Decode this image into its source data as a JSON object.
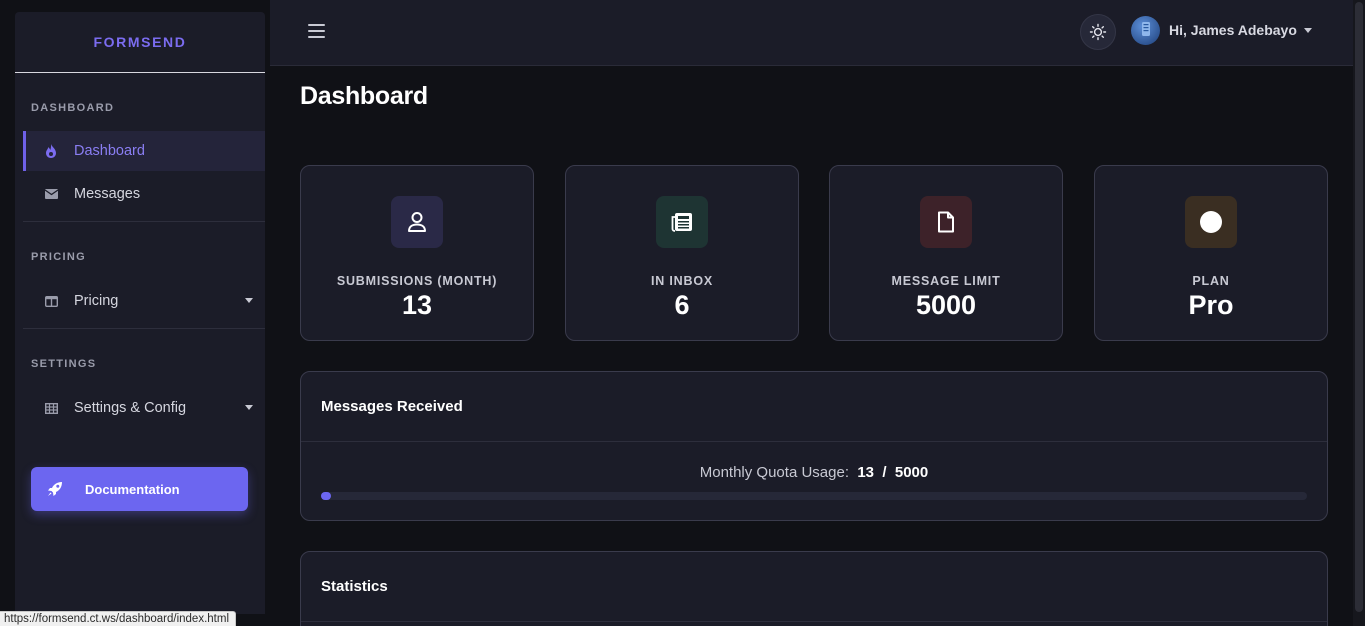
{
  "brand": "FORMSEND",
  "sidebar": {
    "sections": [
      {
        "title": "DASHBOARD",
        "items": [
          {
            "label": "Dashboard",
            "icon": "fire-icon",
            "active": true
          },
          {
            "label": "Messages",
            "icon": "envelope-icon",
            "active": false
          }
        ]
      },
      {
        "title": "PRICING",
        "items": [
          {
            "label": "Pricing",
            "icon": "columns-icon",
            "active": false,
            "dropdown": true
          }
        ]
      },
      {
        "title": "SETTINGS",
        "items": [
          {
            "label": "Settings & Config",
            "icon": "table-icon",
            "active": false,
            "dropdown": true
          }
        ]
      }
    ],
    "doc_button": {
      "label": "Documentation",
      "icon": "rocket-icon"
    }
  },
  "topbar": {
    "menu_icon": "hamburger-icon",
    "theme_icon": "sun-icon",
    "greeting": "Hi, James Adebayo"
  },
  "page_title": "Dashboard",
  "stats": [
    {
      "label": "SUBMISSIONS (MONTH)",
      "value": "13",
      "icon": "user-icon",
      "color": "#8f85f5",
      "bg": "#2a2947"
    },
    {
      "label": "IN INBOX",
      "value": "6",
      "icon": "newspaper-icon",
      "color": "#e8f2ef",
      "bg": "#1e3433"
    },
    {
      "label": "MESSAGE LIMIT",
      "value": "5000",
      "icon": "file-icon",
      "color": "#f3e8ea",
      "bg": "#3d2229"
    },
    {
      "label": "PLAN",
      "value": "Pro",
      "icon": "circle-icon",
      "color": "#ffffff",
      "bg": "#3a2e22"
    }
  ],
  "messages_panel": {
    "title": "Messages Received",
    "quota_label": "Monthly Quota Usage:",
    "used": "13",
    "separator": "/",
    "limit": "5000",
    "progress_fraction": 0.0026
  },
  "statistics_panel": {
    "title": "Statistics"
  },
  "status_url": "https://formsend.ct.ws/dashboard/index.html",
  "colors": {
    "accent": "#6c66f0",
    "background": "#101116",
    "surface": "#1b1c28"
  }
}
